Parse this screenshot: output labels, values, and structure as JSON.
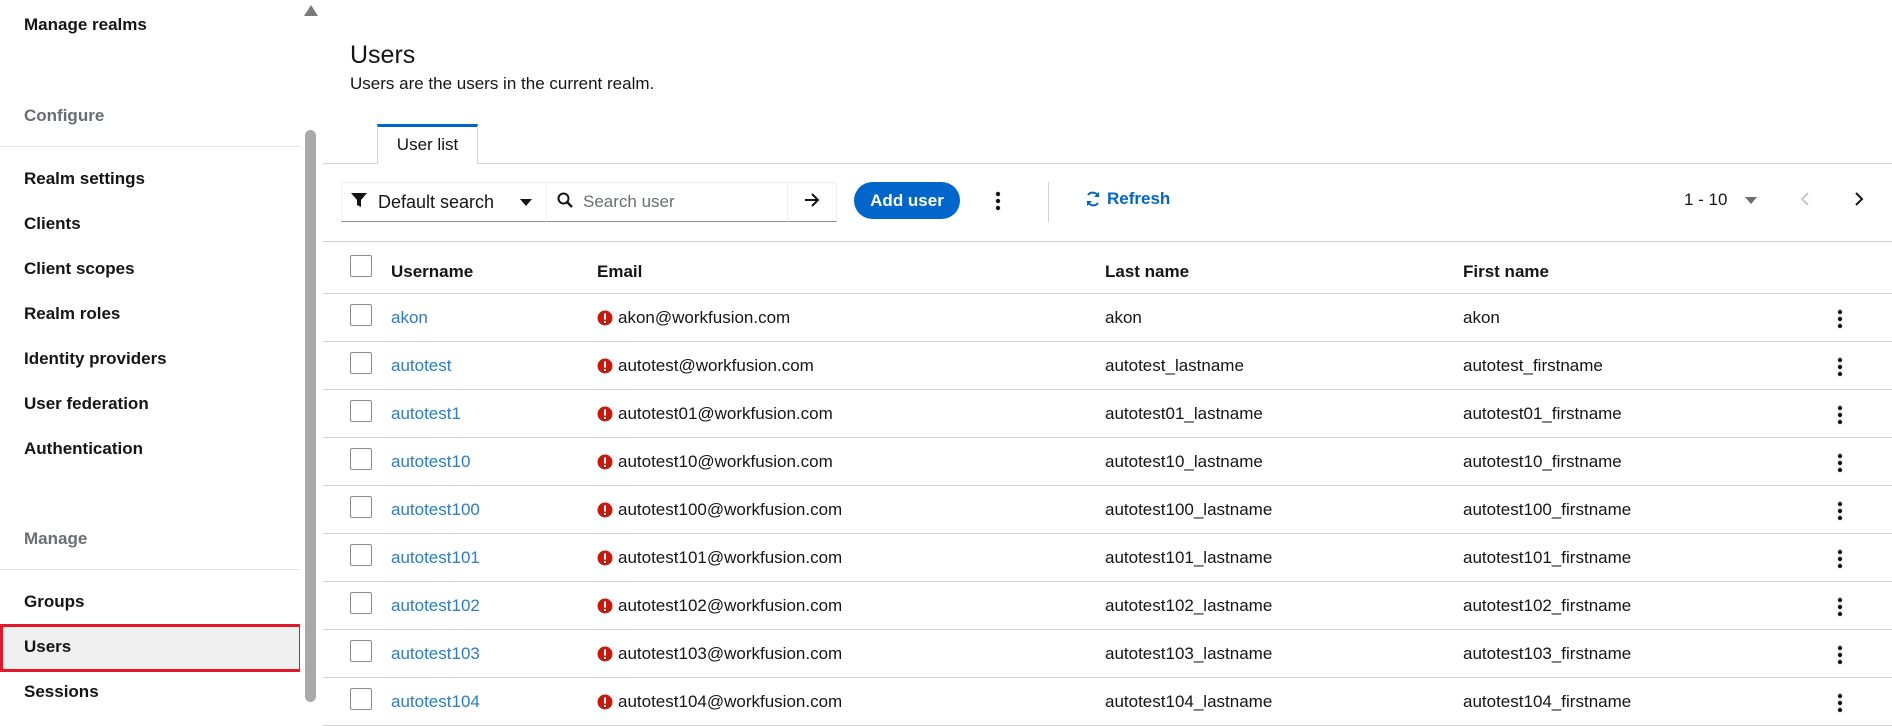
{
  "sidebar": {
    "manage_realms": "Manage realms",
    "configure_title": "Configure",
    "configure_items": [
      "Realm settings",
      "Clients",
      "Client scopes",
      "Realm roles",
      "Identity providers",
      "User federation",
      "Authentication"
    ],
    "manage_title": "Manage",
    "manage_items": [
      "Groups",
      "Users",
      "Sessions"
    ],
    "active_item": "Users"
  },
  "page": {
    "title": "Users",
    "subtitle": "Users are the users in the current realm."
  },
  "tabs": [
    {
      "label": "User list",
      "active": true
    }
  ],
  "toolbar": {
    "filter_label": "Default search",
    "search_placeholder": "Search user",
    "add_user_label": "Add user",
    "refresh_label": "Refresh",
    "pagination_range": "1 - 10"
  },
  "table": {
    "columns": {
      "username": "Username",
      "email": "Email",
      "lastname": "Last name",
      "firstname": "First name"
    },
    "rows": [
      {
        "username": "akon",
        "email": "akon@workfusion.com",
        "lastname": "akon",
        "firstname": "akon"
      },
      {
        "username": "autotest",
        "email": "autotest@workfusion.com",
        "lastname": "autotest_lastname",
        "firstname": "autotest_firstname"
      },
      {
        "username": "autotest1",
        "email": "autotest01@workfusion.com",
        "lastname": "autotest01_lastname",
        "firstname": "autotest01_firstname"
      },
      {
        "username": "autotest10",
        "email": "autotest10@workfusion.com",
        "lastname": "autotest10_lastname",
        "firstname": "autotest10_firstname"
      },
      {
        "username": "autotest100",
        "email": "autotest100@workfusion.com",
        "lastname": "autotest100_lastname",
        "firstname": "autotest100_firstname"
      },
      {
        "username": "autotest101",
        "email": "autotest101@workfusion.com",
        "lastname": "autotest101_lastname",
        "firstname": "autotest101_firstname"
      },
      {
        "username": "autotest102",
        "email": "autotest102@workfusion.com",
        "lastname": "autotest102_lastname",
        "firstname": "autotest102_firstname"
      },
      {
        "username": "autotest103",
        "email": "autotest103@workfusion.com",
        "lastname": "autotest103_lastname",
        "firstname": "autotest103_firstname"
      },
      {
        "username": "autotest104",
        "email": "autotest104@workfusion.com",
        "lastname": "autotest104_lastname",
        "firstname": "autotest104_firstname"
      }
    ]
  },
  "colors": {
    "accent": "#0066cc",
    "link": "#2b7bd1",
    "warning": "#c9190b",
    "highlight_border": "#e3182a"
  },
  "icons": [
    "filter-icon",
    "search-icon",
    "arrow-right-icon",
    "kebab-icon",
    "refresh-icon",
    "chevron-left-icon",
    "chevron-right-icon",
    "exclamation-circle-icon"
  ]
}
